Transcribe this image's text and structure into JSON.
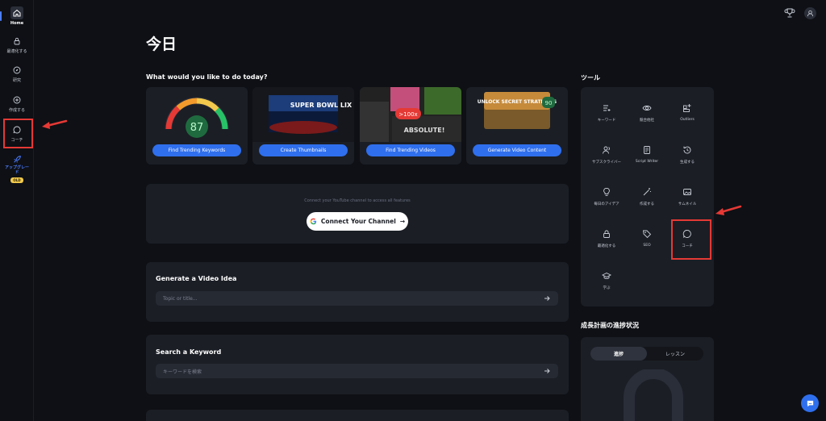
{
  "sidebar": {
    "items": [
      {
        "label": "Home",
        "icon": "home-icon"
      },
      {
        "label": "最適化する",
        "icon": "lock-icon"
      },
      {
        "label": "研究",
        "icon": "compass-icon"
      },
      {
        "label": "作成する",
        "icon": "plus-circle-icon"
      },
      {
        "label": "コーチ",
        "icon": "chat-bubble-icon"
      }
    ],
    "upgrade": {
      "label": "アップグレード",
      "badge": "OLD"
    }
  },
  "header": {
    "title": "今日"
  },
  "main": {
    "prompt": "What would you like to do today?",
    "features": [
      {
        "button": "Find Trending Keywords",
        "score": "87"
      },
      {
        "button": "Create Thumbnails",
        "thumb_text": "SUPER BOWL LIX"
      },
      {
        "button": "Find Trending Videos",
        "badge": ">100x",
        "thumb_text": "ABSOLUTE!"
      },
      {
        "button": "Generate Video Content",
        "thumb_text": "UNLOCK SECRET STRATEGIES",
        "score": "90"
      }
    ],
    "connect": {
      "hint": "Connect your YouTube channel to access all features",
      "button": "Connect Your Channel"
    },
    "video_idea": {
      "title": "Generate a Video Idea",
      "placeholder": "Topic or title..."
    },
    "keyword": {
      "title": "Search a Keyword",
      "placeholder": "キーワードを検索"
    }
  },
  "tools": {
    "title": "ツール",
    "items": [
      {
        "label": "キーワード",
        "icon": "keyword-icon"
      },
      {
        "label": "競合他社",
        "icon": "eye-icon"
      },
      {
        "label": "Outliers",
        "icon": "outliers-icon"
      },
      {
        "label": "サブスクライバー",
        "icon": "subscribers-icon"
      },
      {
        "label": "Script Writer",
        "icon": "script-icon"
      },
      {
        "label": "生成する",
        "icon": "history-icon"
      },
      {
        "label": "毎日のアイデア",
        "icon": "lightbulb-icon"
      },
      {
        "label": "作成する",
        "icon": "magic-wand-icon"
      },
      {
        "label": "サムネイル",
        "icon": "image-icon"
      },
      {
        "label": "最適化する",
        "icon": "lock-icon"
      },
      {
        "label": "SEO",
        "icon": "tag-icon"
      },
      {
        "label": "コーチ",
        "icon": "chat-bubble-icon"
      },
      {
        "label": "学ぶ",
        "icon": "graduation-cap-icon"
      }
    ]
  },
  "progress": {
    "title": "成長計画の進捗状況",
    "tabs": [
      "進捗",
      "レッスン"
    ]
  },
  "colors": {
    "accent": "#2f6fed",
    "highlight": "#e53935",
    "panel": "#1b1e25",
    "background": "#0e1015"
  }
}
